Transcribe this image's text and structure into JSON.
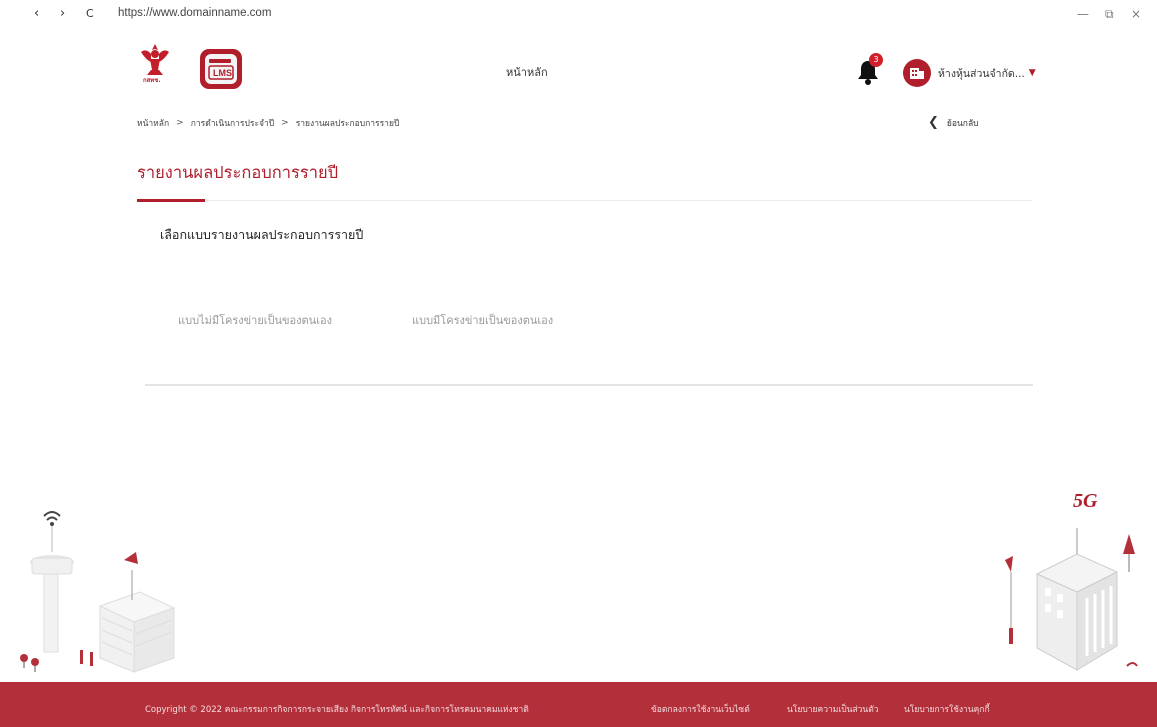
{
  "browser": {
    "back": "‹",
    "forward": "›",
    "reload": "C",
    "url": "https://www.domainname.com",
    "minimize": "—",
    "restore": "⧉",
    "close": "×"
  },
  "header": {
    "logo_caption": "กสทช.",
    "lms_logo_text": "LMS",
    "nav_home": "หน้าหลัก",
    "notification_count": "3",
    "company_name": "ห้างหุ้นส่วนจำกัด..."
  },
  "breadcrumb": {
    "items": [
      "หน้าหลัก",
      "การดำเนินการประจำปี",
      "รายงานผลประกอบการรายปี"
    ],
    "separator": ">"
  },
  "back": {
    "label": "ย้อนกลับ"
  },
  "page": {
    "title": "รายงานผลประกอบการรายปี",
    "section_heading": "เลือกแบบรายงานผลประกอบการรายปี",
    "options": [
      "แบบไม่มีโครงข่ายเป็นของตนเอง",
      "แบบมีโครงข่ายเป็นของตนเอง"
    ]
  },
  "illustration": {
    "badge_5g": "5G"
  },
  "footer": {
    "copyright": "Copyright © 2022 คณะกรรมการกิจการกระจายเสียง กิจการโทรทัศน์ และกิจการโทรคมนาคมแห่งชาติ",
    "links": [
      "ข้อตกลงการใช้งานเว็บไซต์",
      "นโยบายความเป็นส่วนตัว",
      "นโยบายการใช้งานคุกกี้"
    ]
  },
  "colors": {
    "brand": "#b01e2c",
    "footer_bg": "#b3303b",
    "accent_rule": "#b01e2c"
  },
  "icons": [
    "bell-icon",
    "building-icon",
    "caret-down-icon",
    "chevron-left-icon",
    "chevron-right-icon"
  ]
}
